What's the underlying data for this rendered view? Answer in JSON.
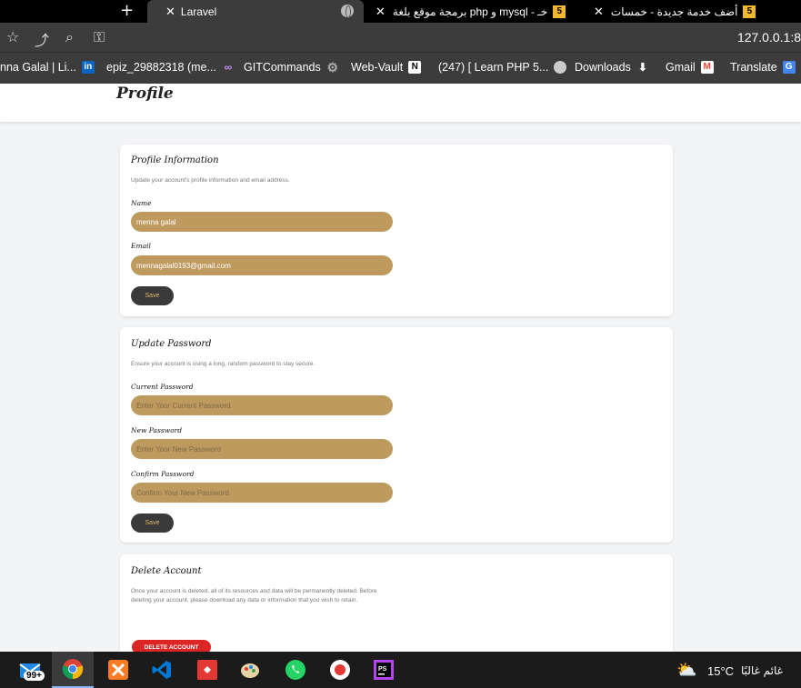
{
  "browser": {
    "new_tab_glyph": "+",
    "tabs": [
      {
        "title": "Laravel",
        "active": true,
        "close": "✕"
      },
      {
        "title": "برمجة موقع بلغة php و mysql - خـ",
        "favicon": "5",
        "close": "✕"
      },
      {
        "title": "أضف خدمة جديدة - خمسات",
        "favicon": "5",
        "close": "✕"
      }
    ],
    "url": "127.0.0.1:8",
    "bookmarks": [
      {
        "label": "nna Galal | Li...",
        "icon": "linkedin-icon"
      },
      {
        "label": "epiz_29882318 (me...",
        "icon": "infinity-icon"
      },
      {
        "label": "GITCommands",
        "icon": "gear-icon"
      },
      {
        "label": "Web-Vault",
        "icon": "notion-icon"
      },
      {
        "label": "(247) [ Learn PHP 5...",
        "icon": "globe-icon"
      },
      {
        "label": "Downloads",
        "icon": "download-icon"
      },
      {
        "label": "Gmail",
        "icon": "gmail-icon"
      },
      {
        "label": "Translate",
        "icon": "translate-icon"
      }
    ]
  },
  "page": {
    "title": "Profile",
    "profile_info": {
      "title": "Profile Information",
      "description": "Update your account's profile information and email address.",
      "name_label": "Name",
      "name_value": "menna galal",
      "email_label": "Email",
      "email_value": "mennagalal0193@gmail.com",
      "save_label": "Save"
    },
    "update_password": {
      "title": "Update Password",
      "description": "Ensure your account is using a long, random password to stay secure.",
      "current_label": "Current Password",
      "current_placeholder": "Enter Your Current Password",
      "new_label": "New Password",
      "new_placeholder": "Enter Your New Password",
      "confirm_label": "Confirm Password",
      "confirm_placeholder": "Confirm Your New Password",
      "save_label": "Save"
    },
    "delete_account": {
      "title": "Delete Account",
      "description": "Once your account is deleted, all of its resources and data will be permanently deleted. Before deleting your account, please download any data or information that you wish to retain.",
      "button_label": "DELETE ACCOUNT"
    }
  },
  "taskbar": {
    "apps": [
      "mail-icon",
      "chrome-icon",
      "xampp-icon",
      "vscode-icon",
      "anydesk-icon",
      "paint-icon",
      "whatsapp-icon",
      "record-icon",
      "phpstorm-icon"
    ],
    "badge": "99+",
    "temperature": "15°C",
    "condition": "غائم غالبًا"
  },
  "colors": {
    "input_bg": "#bf9a5e",
    "button_dark": "#3a3a3a",
    "danger": "#dc2626"
  }
}
